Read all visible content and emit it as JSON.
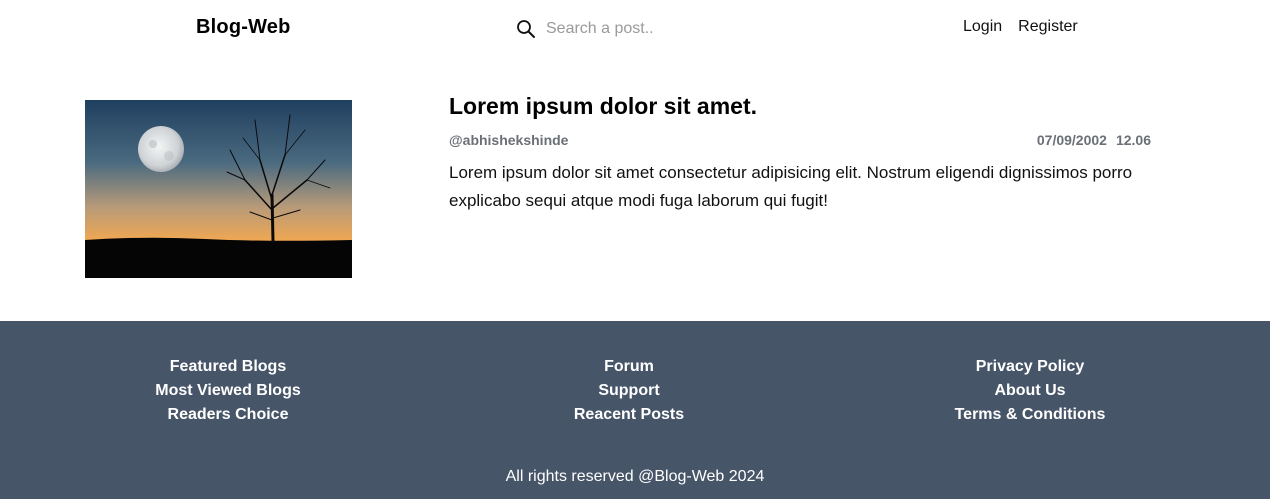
{
  "header": {
    "brand": "Blog-Web",
    "search": {
      "placeholder": "Search a post..",
      "value": ""
    },
    "nav": {
      "login": "Login",
      "register": "Register"
    }
  },
  "post": {
    "title": "Lorem ipsum dolor sit amet.",
    "author": "@abhishekshinde",
    "date": "07/09/2002",
    "time": "12.06",
    "excerpt": "Lorem ipsum dolor sit amet consectetur adipisicing elit. Nostrum eligendi dignissimos porro explicabo sequi atque modi fuga laborum qui fugit!",
    "image_icon": "moonlit-tree-sunset-image"
  },
  "footer": {
    "col1": [
      "Featured Blogs",
      "Most Viewed Blogs",
      "Readers Choice"
    ],
    "col2": [
      "Forum",
      "Support",
      "Reacent Posts"
    ],
    "col3": [
      "Privacy Policy",
      "About Us",
      "Terms & Conditions"
    ],
    "copyright": "All rights reserved @Blog-Web 2024",
    "background": "#475569"
  }
}
